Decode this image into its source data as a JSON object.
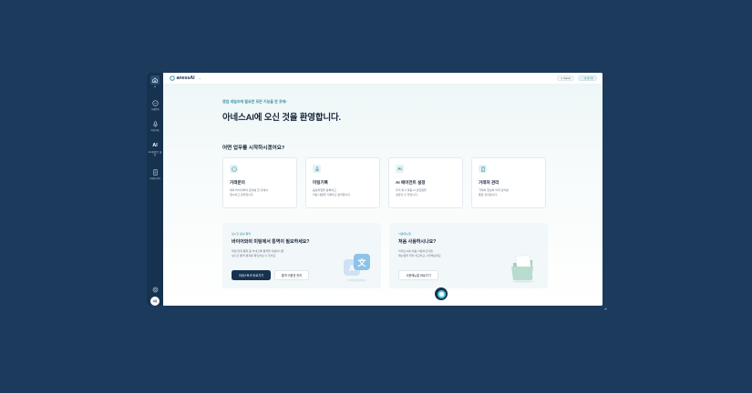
{
  "app": {
    "logo_text": "anessAI"
  },
  "topbar": {
    "plan_label": "Starter",
    "admin_label": "내 관리자"
  },
  "sidebar": {
    "items": [
      {
        "label": "거래문의"
      },
      {
        "label": "미팅기록"
      },
      {
        "label": "AI 에이전트 설정"
      },
      {
        "label": "거래처 관리"
      }
    ],
    "avatar_text": "사용"
  },
  "hero": {
    "eyebrow": "영업 새일즈에 필요한 모든 기능을 한 곳에!",
    "title": "아네스AI에 오신 것을 환영합니다.",
    "section_title": "어떤 업무를 시작하시겠어요?"
  },
  "cards": [
    {
      "title": "거래문의",
      "desc1": "해외 바이어와의 문의를 한 곳에서",
      "desc2": "접수하고 관리합니다."
    },
    {
      "title": "미팅기록",
      "desc1": "음성파일을 등록하고,",
      "desc2": "미팅 내용을 기록하고 분석합니다."
    },
    {
      "title": "AI 에이전트 설정",
      "desc1": "우리 회사 맞춤 AI 상담원을",
      "desc2": "설정할 수 있습니다."
    },
    {
      "title": "거래처 관리",
      "desc1": "거래처 정보와 이력 관리를",
      "desc2": "통합 관리합니다."
    }
  ],
  "promo_left": {
    "eyebrow": "실시간 음성 통역",
    "title": "바이어와의 미팅에서 통역이 필요하세요?",
    "desc1": "화상/전화 통화 중 아네스톡 통역을 이용하시면",
    "desc2": "실시간 통역 결과를 확인하실 수 있어요.",
    "primary_button": "아네스토크 바로가기",
    "secondary_button": "통역 이용권 관리"
  },
  "promo_right": {
    "eyebrow": "사용매뉴얼",
    "title": "처음 사용하시나요?",
    "desc1": "아네스AI를 처음 사용하신다면,",
    "desc2": "매뉴얼을 따라 차근차근 시작해보세요.",
    "button": "사용매뉴얼 바로가기"
  },
  "colors": {
    "navy": "#16324f",
    "accent": "#3d8fa6",
    "chat_ring": "#4fd0e0"
  }
}
